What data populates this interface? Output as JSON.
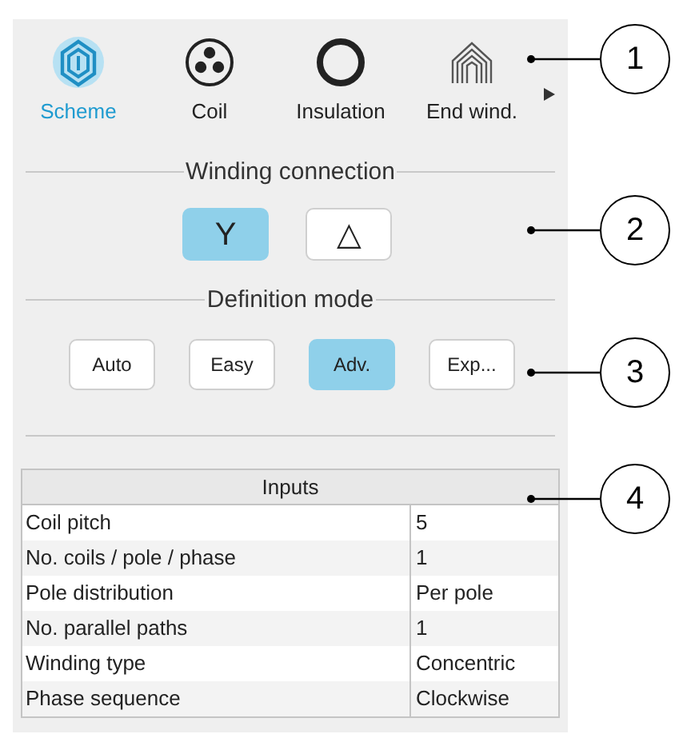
{
  "tabs": [
    {
      "label": "Scheme",
      "kind": "scheme",
      "selected": true
    },
    {
      "label": "Coil",
      "kind": "coil",
      "selected": false
    },
    {
      "label": "Insulation",
      "kind": "insulation",
      "selected": false
    },
    {
      "label": "End wind.",
      "kind": "endwinding",
      "selected": false
    }
  ],
  "winding_connection": {
    "title": "Winding connection",
    "options": [
      {
        "label": "Y",
        "selected": true
      },
      {
        "label": "△",
        "selected": false
      }
    ]
  },
  "definition_mode": {
    "title": "Definition mode",
    "options": [
      {
        "label": "Auto",
        "selected": false
      },
      {
        "label": "Easy",
        "selected": false
      },
      {
        "label": "Adv.",
        "selected": true
      },
      {
        "label": "Exp...",
        "selected": false
      }
    ]
  },
  "inputs_table": {
    "title": "Inputs",
    "rows": [
      {
        "name": "Coil pitch",
        "value": "5"
      },
      {
        "name": "No. coils / pole / phase",
        "value": "1"
      },
      {
        "name": "Pole distribution",
        "value": "Per pole"
      },
      {
        "name": "No. parallel paths",
        "value": "1"
      },
      {
        "name": "Winding type",
        "value": "Concentric"
      },
      {
        "name": "Phase sequence",
        "value": "Clockwise"
      }
    ]
  },
  "callouts": [
    "1",
    "2",
    "3",
    "4"
  ]
}
